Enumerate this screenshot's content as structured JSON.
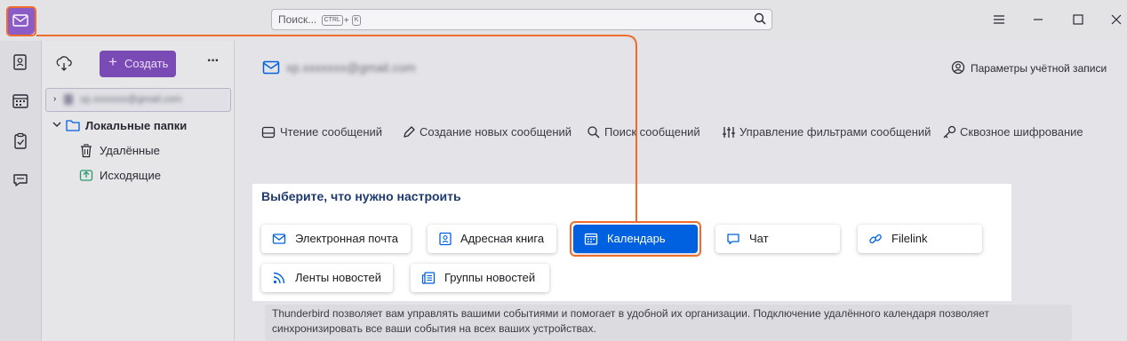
{
  "titlebar": {
    "search_placeholder": "Поиск...",
    "search_key1": "CTRL",
    "search_key_plus": "+",
    "search_key2": "K"
  },
  "spaces": [
    "mail",
    "address-book",
    "calendar",
    "tasks",
    "chat"
  ],
  "folder_pane": {
    "create_label": "Создать",
    "more_label": "···",
    "account_name": "xp.xxxxxxx@gmail.com",
    "local_folders": "Локальные папки",
    "folders": [
      "Удалённые",
      "Исходящие"
    ]
  },
  "main": {
    "account_email": "xp.xxxxxxx@gmail.com",
    "account_settings": "Параметры учётной записи",
    "features": [
      "Чтение сообщений",
      "Создание новых сообщений",
      "Поиск сообщений",
      "Управление фильтрами сообщений",
      "Сквозное шифрование"
    ],
    "setup_title": "Выберите, что нужно настроить",
    "options": [
      "Электронная почта",
      "Адресная книга",
      "Календарь",
      "Чат",
      "Filelink",
      "Ленты новостей",
      "Группы новостей"
    ],
    "description": "Thunderbird позволяет вам управлять вашими событиями и помогает в удобной их организации. Подключение удалённого календаря позволяет синхронизировать все ваши события на всех ваших устройствах."
  },
  "colors": {
    "accent": "#0061e0",
    "highlight": "#ee6c2c",
    "create_button": "#7a4bb5"
  }
}
